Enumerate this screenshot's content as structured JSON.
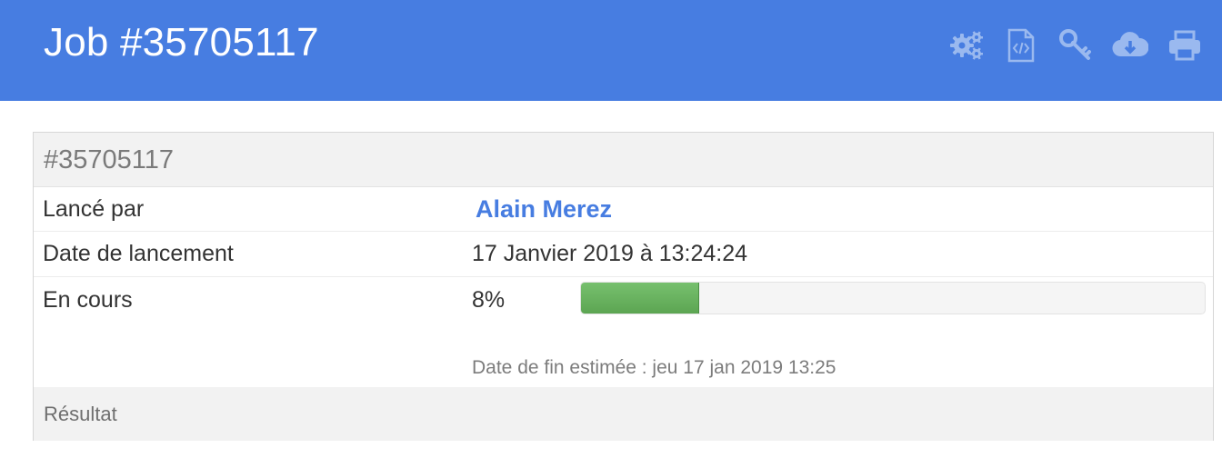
{
  "header": {
    "title": "Job #35705117",
    "background": "#477de1",
    "tools": [
      "gears-icon",
      "code-file-icon",
      "key-icon",
      "cloud-download-icon",
      "print-icon"
    ]
  },
  "panel": {
    "heading": "#35705117",
    "rows": {
      "launched_by": {
        "label": "Lancé par",
        "value": "Alain Merez"
      },
      "launch_date": {
        "label": "Date de lancement",
        "value": "17 Janvier 2019 à 13:24:24"
      },
      "status": {
        "label": "En cours",
        "percent_text": "8%",
        "progress_fraction": 0.19,
        "eta": "Date de fin estimée : jeu 17 jan 2019 13:25"
      }
    },
    "footer": "Résultat"
  },
  "colors": {
    "accent": "#477de1",
    "progress": "#6ab360"
  }
}
